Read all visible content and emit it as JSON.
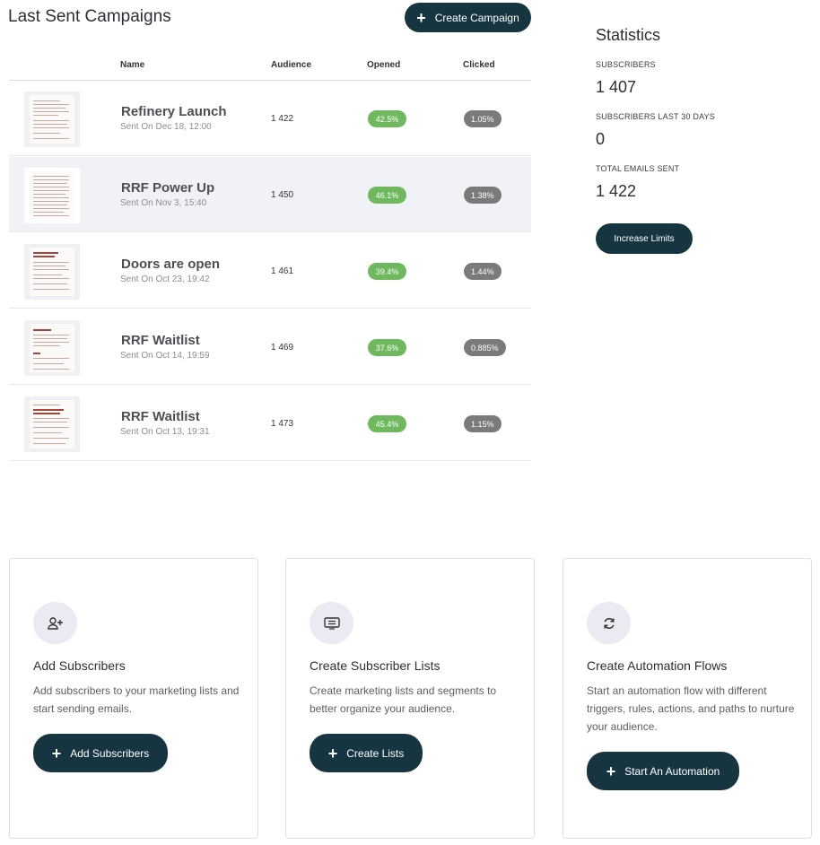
{
  "header": {
    "title": "Last Sent Campaigns",
    "create_campaign_label": "Create Campaign"
  },
  "table": {
    "columns": [
      "Name",
      "Audience",
      "Opened",
      "Clicked"
    ],
    "rows": [
      {
        "name": "Refinery Launch",
        "sent": "Sent On Dec 18, 12:00",
        "audience": "1 422",
        "opened": "42.5%",
        "clicked": "1.05%"
      },
      {
        "name": "RRF Power Up",
        "sent": "Sent On Nov 3, 15:40",
        "audience": "1 450",
        "opened": "46.1%",
        "clicked": "1.38%"
      },
      {
        "name": "Doors are open",
        "sent": "Sent On Oct 23, 19:42",
        "audience": "1 461",
        "opened": "39.4%",
        "clicked": "1.44%"
      },
      {
        "name": "RRF Waitlist",
        "sent": "Sent On Oct 14, 19:59",
        "audience": "1 469",
        "opened": "37.6%",
        "clicked": "0.885%"
      },
      {
        "name": "RRF Waitlist",
        "sent": "Sent On Oct 13, 19:31",
        "audience": "1 473",
        "opened": "45.4%",
        "clicked": "1.15%"
      }
    ]
  },
  "statistics": {
    "title": "Statistics",
    "items": [
      {
        "label": "SUBSCRIBERS",
        "value": "1 407"
      },
      {
        "label": "SUBSCRIBERS LAST 30 DAYS",
        "value": "0"
      },
      {
        "label": "TOTAL EMAILS SENT",
        "value": "1 422"
      }
    ],
    "increase_label": "Increase Limits"
  },
  "cards": [
    {
      "icon": "add-user-icon",
      "title": "Add Subscribers",
      "desc": "Add subscribers to your marketing lists and start sending emails.",
      "button": "Add Subscribers"
    },
    {
      "icon": "list-icon",
      "title": "Create Subscriber Lists",
      "desc": "Create marketing lists and segments to better organize your audience.",
      "button": "Create Lists"
    },
    {
      "icon": "refresh-icon",
      "title": "Create Automation Flows",
      "desc": "Start an automation flow with different triggers, rules, actions, and paths to nurture your audience.",
      "button": "Start An Automation"
    }
  ],
  "colors": {
    "primary": "#173540",
    "opened": "#6fb85e",
    "clicked": "#7a7a7a",
    "highlight_row": "#f0f2f7"
  }
}
